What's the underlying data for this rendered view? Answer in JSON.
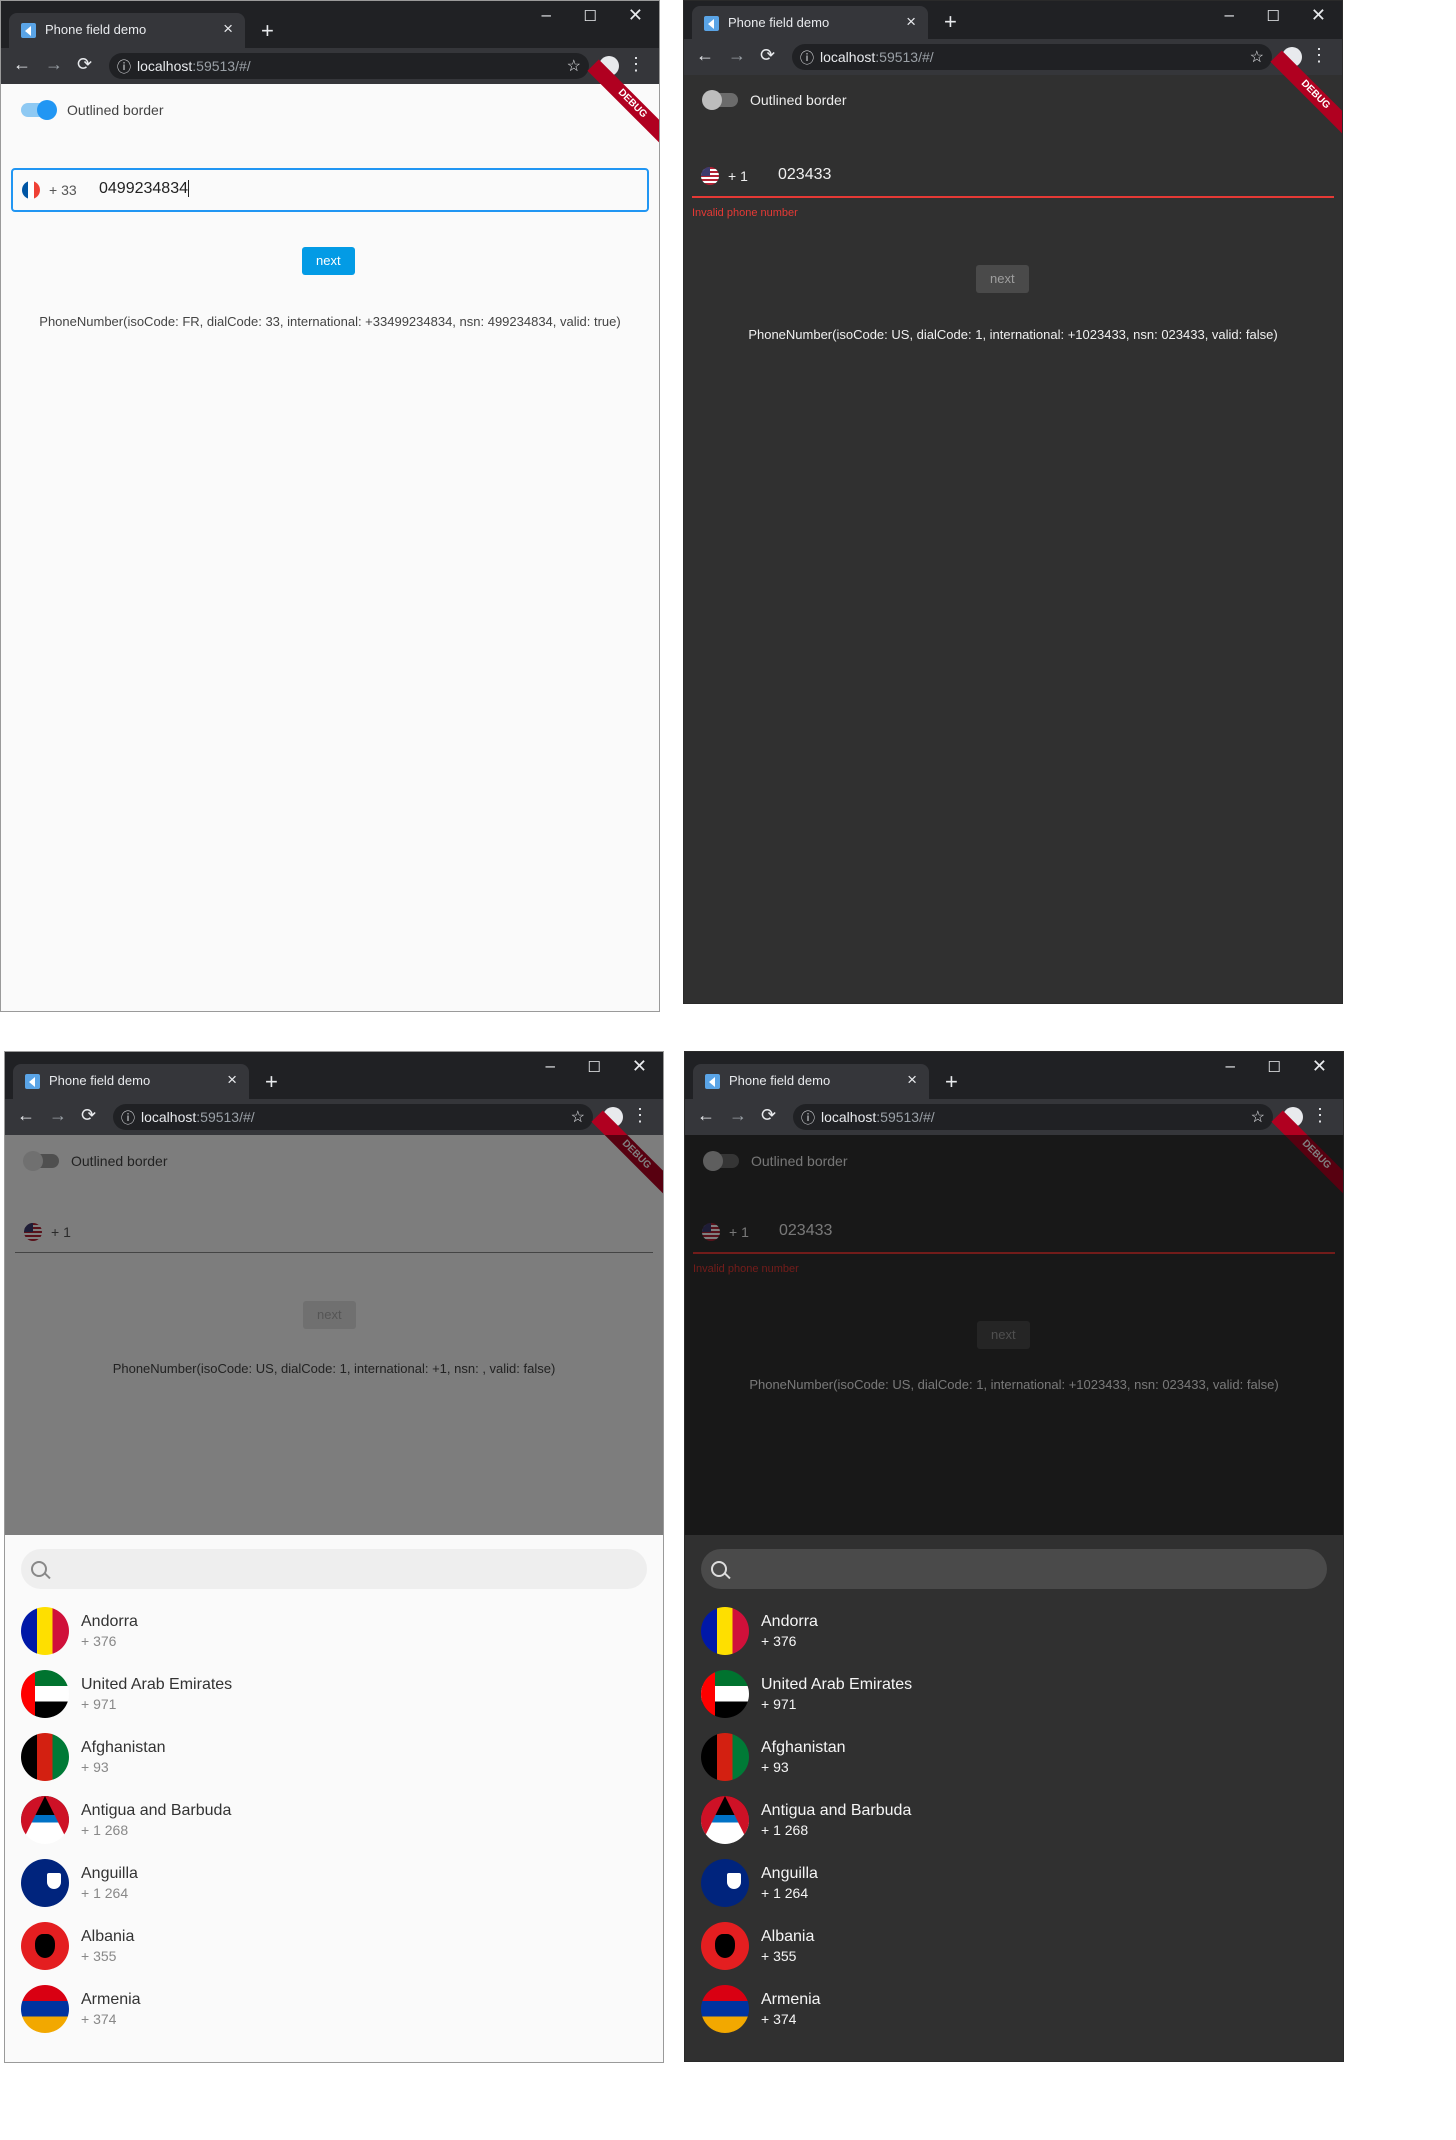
{
  "browser": {
    "tab_title": "Phone field demo",
    "tab_close": "×",
    "new_tab": "+",
    "url_host": "localhost",
    "url_port": ":59513/#/",
    "back": "←",
    "forward": "→",
    "reload": "⟳",
    "info": "ⓘ",
    "star": "☆",
    "menu": "⋮",
    "minimize": "–",
    "maximize": "☐",
    "close": "✕"
  },
  "debug_label": "DEBUG",
  "toggle_label": "Outlined border",
  "next_label": "next",
  "screens": {
    "light_outlined": {
      "dial_code": "+ 33",
      "phone_value": "0499234834",
      "result": "PhoneNumber(isoCode: FR, dialCode: 33, international: +33499234834, nsn: 499234834, valid: true)"
    },
    "dark_error": {
      "dial_code": "+ 1",
      "phone_value": "023433",
      "error": "Invalid phone number",
      "result": "PhoneNumber(isoCode: US, dialCode: 1, international: +1023433, nsn: 023433, valid: false)"
    },
    "light_picker": {
      "dial_code": "+ 1",
      "result": "PhoneNumber(isoCode: US, dialCode: 1, international: +1, nsn: , valid: false)"
    },
    "dark_picker": {
      "dial_code": "+ 1",
      "phone_value": "023433",
      "error": "Invalid phone number",
      "result": "PhoneNumber(isoCode: US, dialCode: 1, international: +1023433, nsn: 023433, valid: false)"
    }
  },
  "countries": [
    {
      "name": "Andorra",
      "dial": "+ 376",
      "flag": "andorra-flag-icon"
    },
    {
      "name": "United Arab Emirates",
      "dial": "+ 971",
      "flag": "uae-flag-icon"
    },
    {
      "name": "Afghanistan",
      "dial": "+ 93",
      "flag": "afghanistan-flag-icon"
    },
    {
      "name": "Antigua and Barbuda",
      "dial": "+ 1 268",
      "flag": "antigua-flag-icon"
    },
    {
      "name": "Anguilla",
      "dial": "+ 1 264",
      "flag": "anguilla-flag-icon"
    },
    {
      "name": "Albania",
      "dial": "+ 355",
      "flag": "albania-flag-icon"
    },
    {
      "name": "Armenia",
      "dial": "+ 374",
      "flag": "armenia-flag-icon"
    }
  ],
  "colors": {
    "accent": "#2196f3",
    "button": "#039be5",
    "error": "#e53935",
    "dark_bg": "#303030",
    "light_bg": "#fafafa"
  }
}
